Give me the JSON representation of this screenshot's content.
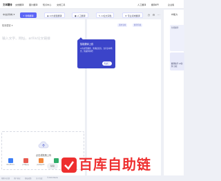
{
  "topnav": {
    "brand": "文本翻译",
    "items": [
      "文档翻译",
      "图片翻译",
      "知识中心",
      "文档工具"
    ],
    "right": [
      "人工翻译",
      "翻译API",
      "企业版"
    ]
  },
  "toolbar": {
    "source_lang": "中文(简体)",
    "chips": [
      {
        "label": "智能翻译"
      },
      {
        "label": "AI大模型翻译"
      },
      {
        "label": "人工翻译"
      },
      {
        "label": "AI论文润色"
      },
      {
        "label": "专业领域翻译"
      }
    ]
  },
  "source": {
    "detected_label": "检测语言",
    "placeholder": "输入文字、网址、arXiv论文链接"
  },
  "target": {
    "tags": [
      "通用领域",
      "翻译风格"
    ]
  },
  "sidebar": {
    "heading": "AI能力",
    "card_a_text": "智能翻译",
    "card_b_text": "翻译助手 AI创作 分析"
  },
  "tooltip": {
    "title": "智能翻译上线",
    "body": "AI大模型翻译，准确度更高，支持多种场景，快速体验吧！",
    "ok_label": "知道了"
  },
  "upload": {
    "title": "点击或拖拽上传",
    "file_types": [
      "doc/docx",
      "pdf/jpg",
      "ppt/pptx",
      "xls",
      "jpg/png"
    ]
  },
  "actions": [
    "粘贴",
    "语音"
  ],
  "footer": [
    "帮助与反馈",
    "用户协议",
    "隐私政策",
    "关于百度",
    "©2024 Baidu"
  ],
  "watermark": {
    "text": "百库自助链"
  }
}
